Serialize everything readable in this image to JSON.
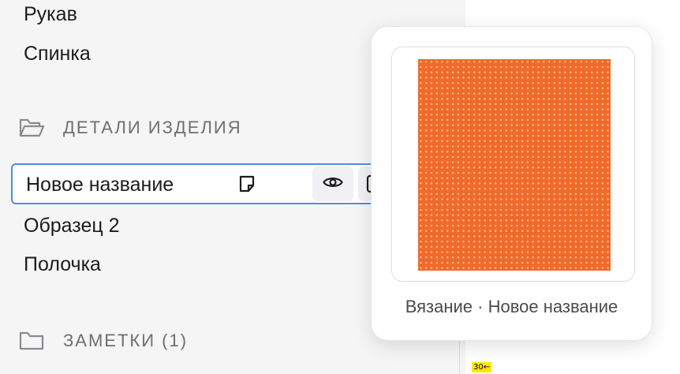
{
  "sidebar": {
    "items_top": [
      "Рукав",
      "Спинка"
    ],
    "section_details": {
      "label": "ДЕТАЛИ ИЗДЕЛИЯ",
      "icon": "folder-open-icon"
    },
    "selected_item": {
      "label": "Новое название"
    },
    "items_details": [
      "Образец 2",
      "Полочка"
    ],
    "section_notes": {
      "label": "ЗАМЕТКИ (1)",
      "icon": "folder-icon"
    }
  },
  "popover": {
    "caption": "Вязание · Новое название",
    "swatch_color": "#f06a2a",
    "swatch_stitch_color": "#ffd4bd"
  },
  "debug_tag": "30←",
  "colors": {
    "selection_border": "#4a90e2",
    "sidebar_bg": "#f5f5f6",
    "muted_text": "#6e6e73"
  }
}
